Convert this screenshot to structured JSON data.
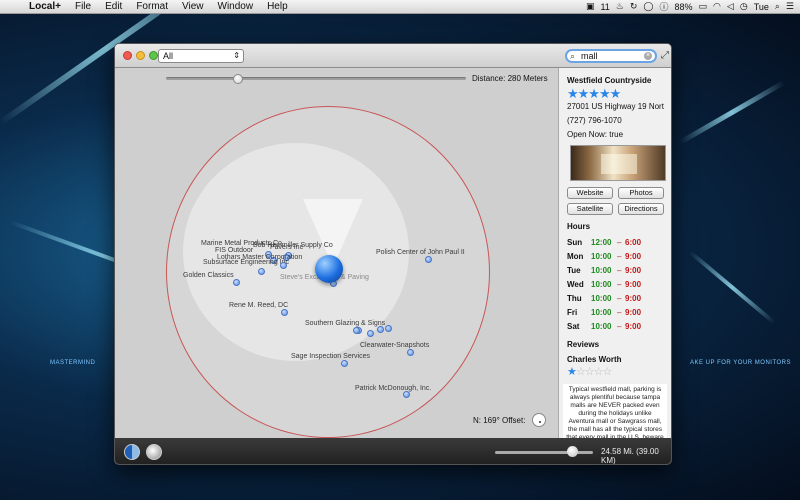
{
  "menubar": {
    "app_name": "Local+",
    "items": [
      "File",
      "Edit",
      "Format",
      "View",
      "Window",
      "Help"
    ],
    "status": {
      "adobe_label": "11",
      "battery": "88%",
      "day": "Tue"
    }
  },
  "toolbar": {
    "filter_value": "All",
    "search_value": "mall"
  },
  "map": {
    "distance_label": "Distance:  280 Meters",
    "distance_slider_fraction": 0.24,
    "compass_label": "N:  169° Offset:",
    "pois": [
      {
        "label": "Marine Metal Products Co",
        "faded": false
      },
      {
        "label": "FIS Outdoor",
        "faded": false
      },
      {
        "label": "Bob Heinmiller Supply Co",
        "faded": false
      },
      {
        "label": "Pavers Inc",
        "faded": false
      },
      {
        "label": "Subsurface Engineering Inc",
        "faded": false
      },
      {
        "label": "Lothars Master Corporation",
        "faded": false
      },
      {
        "label": "Golden Classics",
        "faded": false
      },
      {
        "label": "Steve's Excavating & Paving",
        "faded": true
      },
      {
        "label": "Polish Center of John Paul II",
        "faded": false
      },
      {
        "label": "Rene M. Reed, DC",
        "faded": false
      },
      {
        "label": "Southern Glazing & Signs",
        "faded": false
      },
      {
        "label": "Clearwater-Snapshots",
        "faded": false
      },
      {
        "label": "Sage Inspection Services",
        "faded": false
      },
      {
        "label": "Patrick McDonough, Inc.",
        "faded": false
      }
    ]
  },
  "details": {
    "name": "Westfield Countryside",
    "rating_stars": "★★★★★",
    "address": "27001 US Highway 19 Nort",
    "phone": "(727) 796-1070",
    "open_now": "Open Now:  true",
    "buttons": {
      "website": "Website",
      "photos": "Photos",
      "satellite": "Satellite",
      "directions": "Directions"
    },
    "hours_title": "Hours",
    "hours": [
      {
        "day": "Sun",
        "open": "12:00",
        "close": "6:00"
      },
      {
        "day": "Mon",
        "open": "10:00",
        "close": "9:00"
      },
      {
        "day": "Tue",
        "open": "10:00",
        "close": "9:00"
      },
      {
        "day": "Wed",
        "open": "10:00",
        "close": "9:00"
      },
      {
        "day": "Thu",
        "open": "10:00",
        "close": "9:00"
      },
      {
        "day": "Fri",
        "open": "10:00",
        "close": "9:00"
      },
      {
        "day": "Sat",
        "open": "10:00",
        "close": "9:00"
      }
    ],
    "dash": "–",
    "reviews_title": "Reviews",
    "reviewer": "Charles Worth",
    "review_stars_filled": "★",
    "review_stars_empty": "☆☆☆☆",
    "review_text": "Typical westfield mall, parking is always plentiful because tampa malls are NEVER packed even during the holidays unlike Aventura mall or Sawgrass mall, the mall has all the typical stores that every mall in the U.S. beware"
  },
  "bottombar": {
    "zoom_label": "24.58 Mi. (39.00 KM)"
  },
  "desktop": {
    "left_caption": "MASTERMIND",
    "right_caption": "AKE UP FOR YOUR MONITORS"
  }
}
